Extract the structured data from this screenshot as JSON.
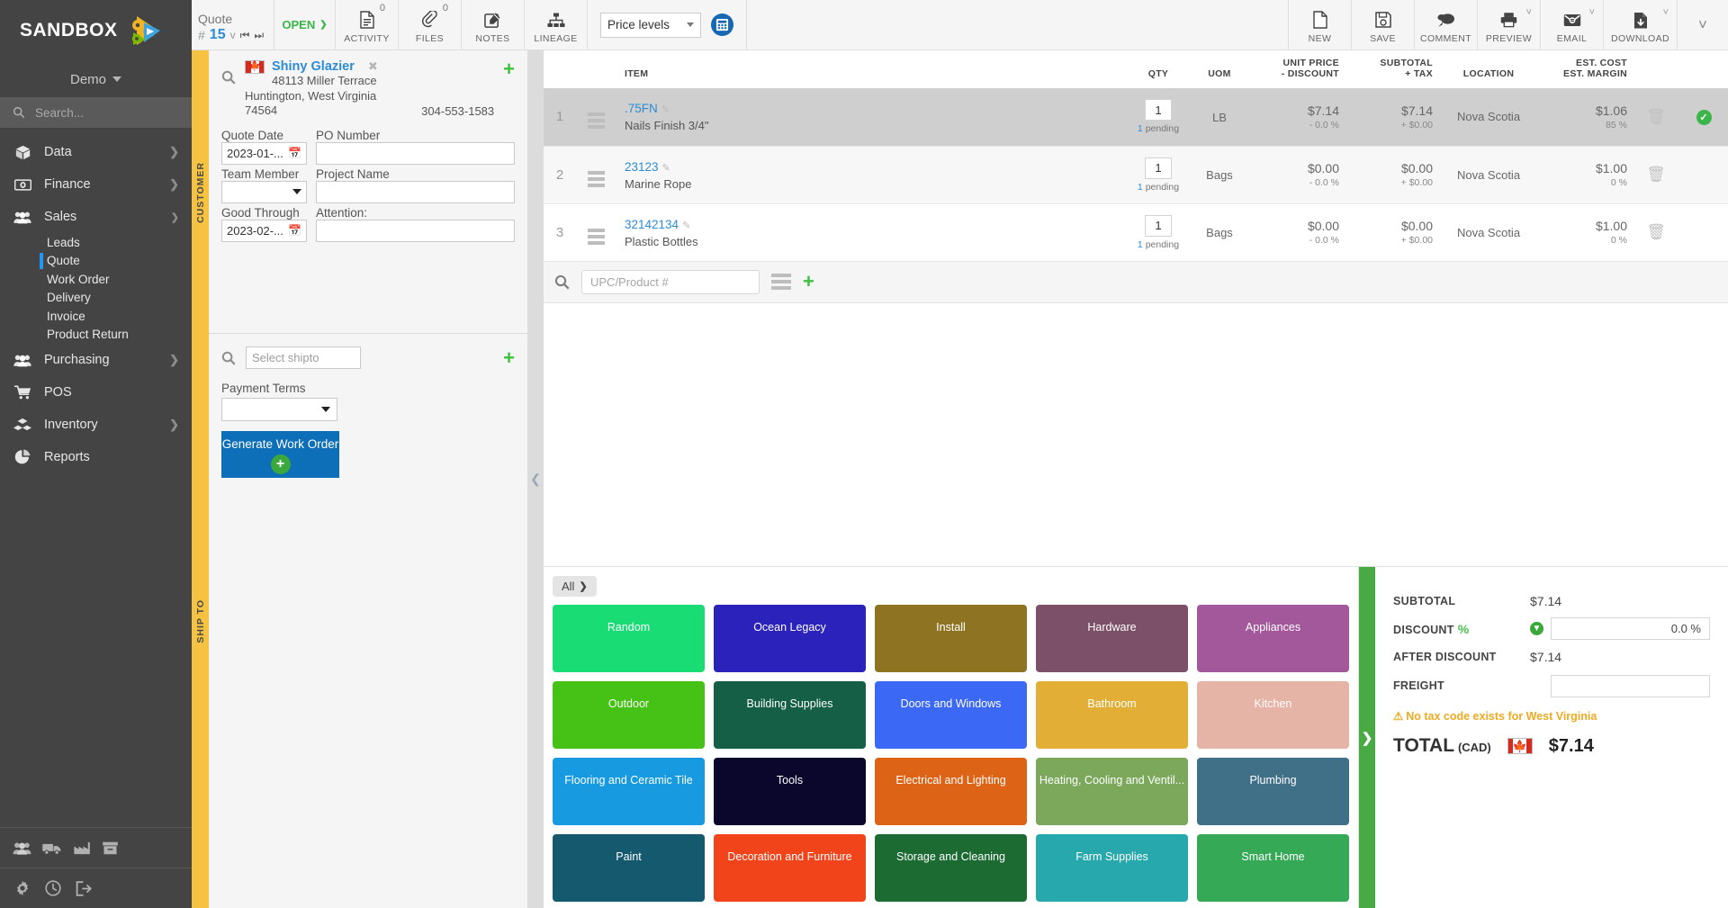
{
  "brand": {
    "name": "SANDBOX",
    "tenant": "Demo",
    "accent_blue": "#2d8bd6",
    "accent_green": "#3cb54a",
    "sidebar_bg": "#444445",
    "tab_yellow": "#f5c242"
  },
  "search": {
    "placeholder": "Search..."
  },
  "sidebar": {
    "items": [
      {
        "label": "Data",
        "icon": "box-icon",
        "expandable": true,
        "expanded": false
      },
      {
        "label": "Finance",
        "icon": "money-icon",
        "expandable": true,
        "expanded": false
      },
      {
        "label": "Sales",
        "icon": "people-icon",
        "expandable": true,
        "expanded": true
      },
      {
        "label": "Purchasing",
        "icon": "people-icon",
        "expandable": true,
        "expanded": false
      },
      {
        "label": "POS",
        "icon": "cart-icon",
        "expandable": false,
        "expanded": false
      },
      {
        "label": "Inventory",
        "icon": "boxes-icon",
        "expandable": true,
        "expanded": false
      },
      {
        "label": "Reports",
        "icon": "pie-chart-icon",
        "expandable": false,
        "expanded": false
      }
    ],
    "sales_children": [
      {
        "label": "Leads",
        "active": false
      },
      {
        "label": "Quote",
        "active": true
      },
      {
        "label": "Work Order",
        "active": false
      },
      {
        "label": "Delivery",
        "active": false
      },
      {
        "label": "Invoice",
        "active": false
      },
      {
        "label": "Product Return",
        "active": false
      }
    ],
    "footer_icons_row1": [
      "people-icon",
      "truck-icon",
      "factory-icon",
      "archive-icon"
    ],
    "footer_icons_row2": [
      "gear-icon",
      "clock-icon",
      "logout-icon"
    ]
  },
  "toolbar": {
    "doc_type": "Quote",
    "hash": "#",
    "doc_number": "15",
    "version_caret": "v",
    "status": "OPEN",
    "buttons": [
      {
        "label": "ACTIVITY",
        "icon": "activity-icon",
        "badge": "0",
        "caret": false
      },
      {
        "label": "FILES",
        "icon": "paperclip-icon",
        "badge": "0",
        "caret": false
      },
      {
        "label": "NOTES",
        "icon": "note-edit-icon",
        "badge": "",
        "caret": false
      },
      {
        "label": "LINEAGE",
        "icon": "lineage-icon",
        "badge": "",
        "caret": false
      }
    ],
    "price_levels": "Price levels",
    "calculator_icon": "calculator-icon",
    "right_buttons": [
      {
        "label": "NEW",
        "icon": "page-icon",
        "caret": false
      },
      {
        "label": "SAVE",
        "icon": "floppy-icon",
        "caret": false
      },
      {
        "label": "COMMENT",
        "icon": "comment-icon",
        "caret": false
      },
      {
        "label": "PREVIEW",
        "icon": "printer-icon",
        "caret": true
      },
      {
        "label": "EMAIL",
        "icon": "envelope-icon",
        "caret": true
      },
      {
        "label": "DOWNLOAD",
        "icon": "download-icon",
        "caret": true
      }
    ]
  },
  "customer": {
    "tab_label": "CUSTOMER",
    "name": "Shiny Glazier",
    "address_line1": "48113 Miller Terrace",
    "address_line2": "Huntington, West Virginia",
    "postal": "74564",
    "phone": "304-553-1583",
    "country_flag": "canada-flag-icon",
    "fields": [
      {
        "label": "Quote Date",
        "value": "2023-01-...",
        "type": "date"
      },
      {
        "label": "PO Number",
        "value": "",
        "type": "text"
      },
      {
        "label": "Team Member",
        "value": "",
        "type": "select"
      },
      {
        "label": "Project Name",
        "value": "",
        "type": "text"
      },
      {
        "label": "Good Through",
        "value": "2023-02-...",
        "type": "date"
      },
      {
        "label": "Attention:",
        "value": "",
        "type": "text"
      }
    ]
  },
  "shipto": {
    "tab_label": "SHIP TO",
    "select_placeholder": "Select shipto",
    "payment_terms_label": "Payment Terms",
    "payment_terms_value": "",
    "generate_button": "Generate Work Order"
  },
  "items_table": {
    "columns": [
      "",
      "",
      "ITEM",
      "QTY",
      "UOM",
      "UNIT PRICE\n- DISCOUNT",
      "SUBTOTAL\n+ TAX",
      "LOCATION",
      "EST. COST\nEST. MARGIN",
      "",
      ""
    ],
    "rows": [
      {
        "num": "1",
        "sku": ".75FN",
        "description": "Nails Finish 3/4\"",
        "qty": "1",
        "pending": "1",
        "pending_label": "pending",
        "uom": "LB",
        "unit_price": "$7.14",
        "discount": "- 0.0 %",
        "subtotal": "$7.14",
        "tax": "+ $0.00",
        "location": "Nova Scotia",
        "est_cost": "$1.06",
        "est_margin": "85 %",
        "selected": true,
        "has_check": true
      },
      {
        "num": "2",
        "sku": "23123",
        "description": "Marine Rope",
        "qty": "1",
        "pending": "1",
        "pending_label": "pending",
        "uom": "Bags",
        "unit_price": "$0.00",
        "discount": "- 0.0 %",
        "subtotal": "$0.00",
        "tax": "+ $0.00",
        "location": "Nova Scotia",
        "est_cost": "$1.00",
        "est_margin": "0 %",
        "selected": false,
        "has_check": false
      },
      {
        "num": "3",
        "sku": "32142134",
        "description": "Plastic Bottles",
        "qty": "1",
        "pending": "1",
        "pending_label": "pending",
        "uom": "Bags",
        "unit_price": "$0.00",
        "discount": "- 0.0 %",
        "subtotal": "$0.00",
        "tax": "+ $0.00",
        "location": "Nova Scotia",
        "est_cost": "$1.00",
        "est_margin": "0 %",
        "selected": false,
        "has_check": false
      }
    ],
    "add_row": {
      "placeholder": "UPC/Product #"
    }
  },
  "categories": {
    "all_label": "All",
    "tiles": [
      {
        "label": "Random",
        "color": "#19dd74"
      },
      {
        "label": "Ocean Legacy",
        "color": "#2a22ba"
      },
      {
        "label": "Install",
        "color": "#8e7422"
      },
      {
        "label": "Hardware",
        "color": "#7c5068"
      },
      {
        "label": "Appliances",
        "color": "#a4589c"
      },
      {
        "label": "Outdoor",
        "color": "#45c215"
      },
      {
        "label": "Building Supplies",
        "color": "#155f47"
      },
      {
        "label": "Doors and Windows",
        "color": "#3b69f6"
      },
      {
        "label": "Bathroom",
        "color": "#e3ae36"
      },
      {
        "label": "Kitchen",
        "color": "#e5b4a7"
      },
      {
        "label": "Flooring and Ceramic Tile",
        "color": "#179ae0"
      },
      {
        "label": "Tools",
        "color": "#0a062c"
      },
      {
        "label": "Electrical and Lighting",
        "color": "#dd6416"
      },
      {
        "label": "Heating, Cooling and Ventil...",
        "color": "#7ba css"
      },
      {
        "label": "Plumbing",
        "color": "#3f7087"
      },
      {
        "label": "Paint",
        "color": "#15596e"
      },
      {
        "label": "Decoration and Furniture",
        "color": "#f1441b"
      },
      {
        "label": "Storage and Cleaning",
        "color": "#1c6b33"
      },
      {
        "label": "Farm Supplies",
        "color": "#27a8ac"
      },
      {
        "label": "Smart Home",
        "color": "#36a957"
      }
    ]
  },
  "totals": {
    "subtotal_label": "SUBTOTAL",
    "subtotal_value": "$7.14",
    "discount_label": "DISCOUNT",
    "discount_symbol": "%",
    "discount_value": "0.0 %",
    "after_discount_label": "AFTER DISCOUNT",
    "after_discount_value": "$7.14",
    "freight_label": "FREIGHT",
    "freight_value": "",
    "tax_warning": "No tax code exists for West Virginia",
    "total_label": "TOTAL",
    "total_currency": "(CAD)",
    "total_value": "$7.14"
  }
}
